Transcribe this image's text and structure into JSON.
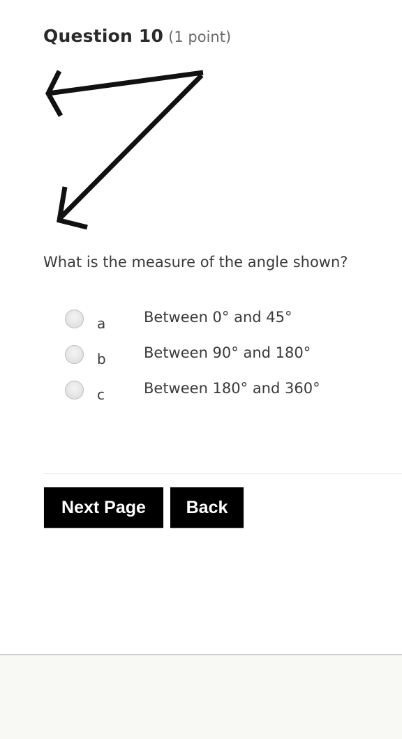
{
  "question": {
    "title": "Question 10",
    "points": "(1 point)",
    "figure": {
      "description": "Two rays sharing a vertex at the upper right: one pointing left, one pointing down-left, forming an acute angle",
      "icon": "angle-figure"
    },
    "prompt": "What is the measure of the angle shown?",
    "options": [
      {
        "letter": "a",
        "text": "Between 0° and 45°",
        "selected": false
      },
      {
        "letter": "b",
        "text": "Between 90° and 180°",
        "selected": false
      },
      {
        "letter": "c",
        "text": "Between 180° and 360°",
        "selected": false
      }
    ]
  },
  "navigation": {
    "next_label": "Next Page",
    "back_label": "Back"
  },
  "colors": {
    "button_bg": "#000000",
    "button_text": "#ffffff",
    "footer_bg": "#f8f8f5"
  }
}
